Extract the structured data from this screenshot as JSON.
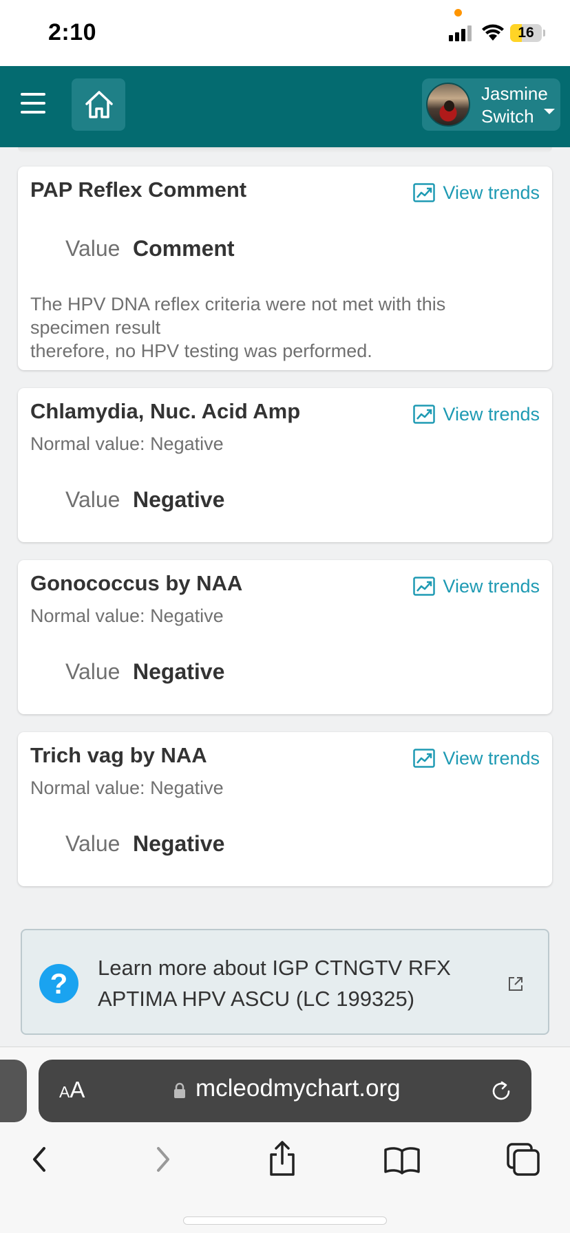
{
  "status_bar": {
    "time": "2:10",
    "battery": "16"
  },
  "header": {
    "user_first": "Jasmine",
    "user_last": "Switch"
  },
  "cards": [
    {
      "title": "PAP Reflex Comment",
      "trend_label": "View trends",
      "value_label": "Value",
      "value": "Comment",
      "comment_lines": [
        "The HPV DNA reflex criteria were not met with this",
        "specimen result",
        "therefore, no HPV testing was performed."
      ]
    },
    {
      "title": "Chlamydia, Nuc. Acid Amp",
      "trend_label": "View trends",
      "normal": "Normal value: Negative",
      "value_label": "Value",
      "value": "Negative"
    },
    {
      "title": "Gonococcus by NAA",
      "trend_label": "View trends",
      "normal": "Normal value: Negative",
      "value_label": "Value",
      "value": "Negative"
    },
    {
      "title": "Trich vag by NAA",
      "trend_label": "View trends",
      "normal": "Normal value: Negative",
      "value_label": "Value",
      "value": "Negative"
    }
  ],
  "learn_more": {
    "line1": "Learn more about IGP CTNGTV RFX",
    "line2": "APTIMA HPV ASCU (LC 199325)",
    "help_glyph": "?"
  },
  "browser": {
    "text_size_small": "A",
    "text_size_large": "A",
    "url": "mcleodmychart.org"
  },
  "colors": {
    "header": "#046b70",
    "link": "#1e9ab3",
    "help": "#1aa3f0"
  }
}
